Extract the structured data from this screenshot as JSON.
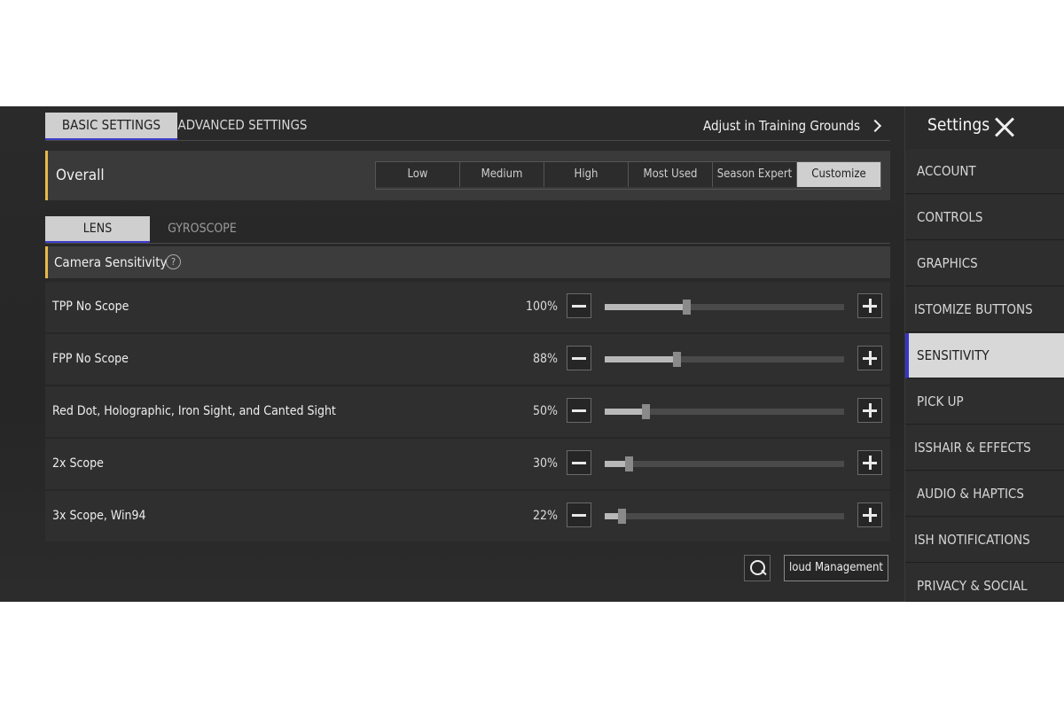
{
  "top_tabs": [
    {
      "label": "BASIC SETTINGS",
      "active": true
    },
    {
      "label": "ADVANCED SETTINGS",
      "active": false
    }
  ],
  "training_link": "Adjust in Training Grounds",
  "overall": {
    "label": "Overall",
    "presets": [
      {
        "label": "Low",
        "active": false
      },
      {
        "label": "Medium",
        "active": false
      },
      {
        "label": "High",
        "active": false
      },
      {
        "label": "Most Used",
        "active": false
      },
      {
        "label": "Season Expert",
        "active": false
      },
      {
        "label": "Customize",
        "active": true
      }
    ]
  },
  "sub_tabs": [
    {
      "label": "LENS",
      "active": true
    },
    {
      "label": "GYROSCOPE",
      "active": false
    }
  ],
  "camera_section": {
    "title": "Camera Sensitivity",
    "help_glyph": "?",
    "rows": [
      {
        "label": "TPP No Scope",
        "value": "100%",
        "level": 0.34
      },
      {
        "label": "FPP No Scope",
        "value": "88%",
        "level": 0.3
      },
      {
        "label": "Red Dot, Holographic, Iron Sight, and Canted Sight",
        "value": "50%",
        "level": 0.17
      },
      {
        "label": "2x Scope",
        "value": "30%",
        "level": 0.1
      },
      {
        "label": "3x Scope, Win94",
        "value": "22%",
        "level": 0.07
      }
    ]
  },
  "bottom": {
    "cloud_label": "loud Management"
  },
  "sidebar": {
    "title": "Settings",
    "items": [
      {
        "label": "ACCOUNT",
        "active": false
      },
      {
        "label": "CONTROLS",
        "active": false
      },
      {
        "label": "GRAPHICS",
        "active": false
      },
      {
        "label": "ISTOMIZE BUTTONS",
        "active": false
      },
      {
        "label": "SENSITIVITY",
        "active": true
      },
      {
        "label": "PICK UP",
        "active": false
      },
      {
        "label": "ISSHAIR & EFFECTS",
        "active": false
      },
      {
        "label": "AUDIO & HAPTICS",
        "active": false
      },
      {
        "label": "ISH NOTIFICATIONS",
        "active": false
      },
      {
        "label": "PRIVACY & SOCIAL",
        "active": false
      }
    ]
  },
  "colors": {
    "accent_blue": "#3c3ccc",
    "accent_yellow": "#e8b84a"
  }
}
